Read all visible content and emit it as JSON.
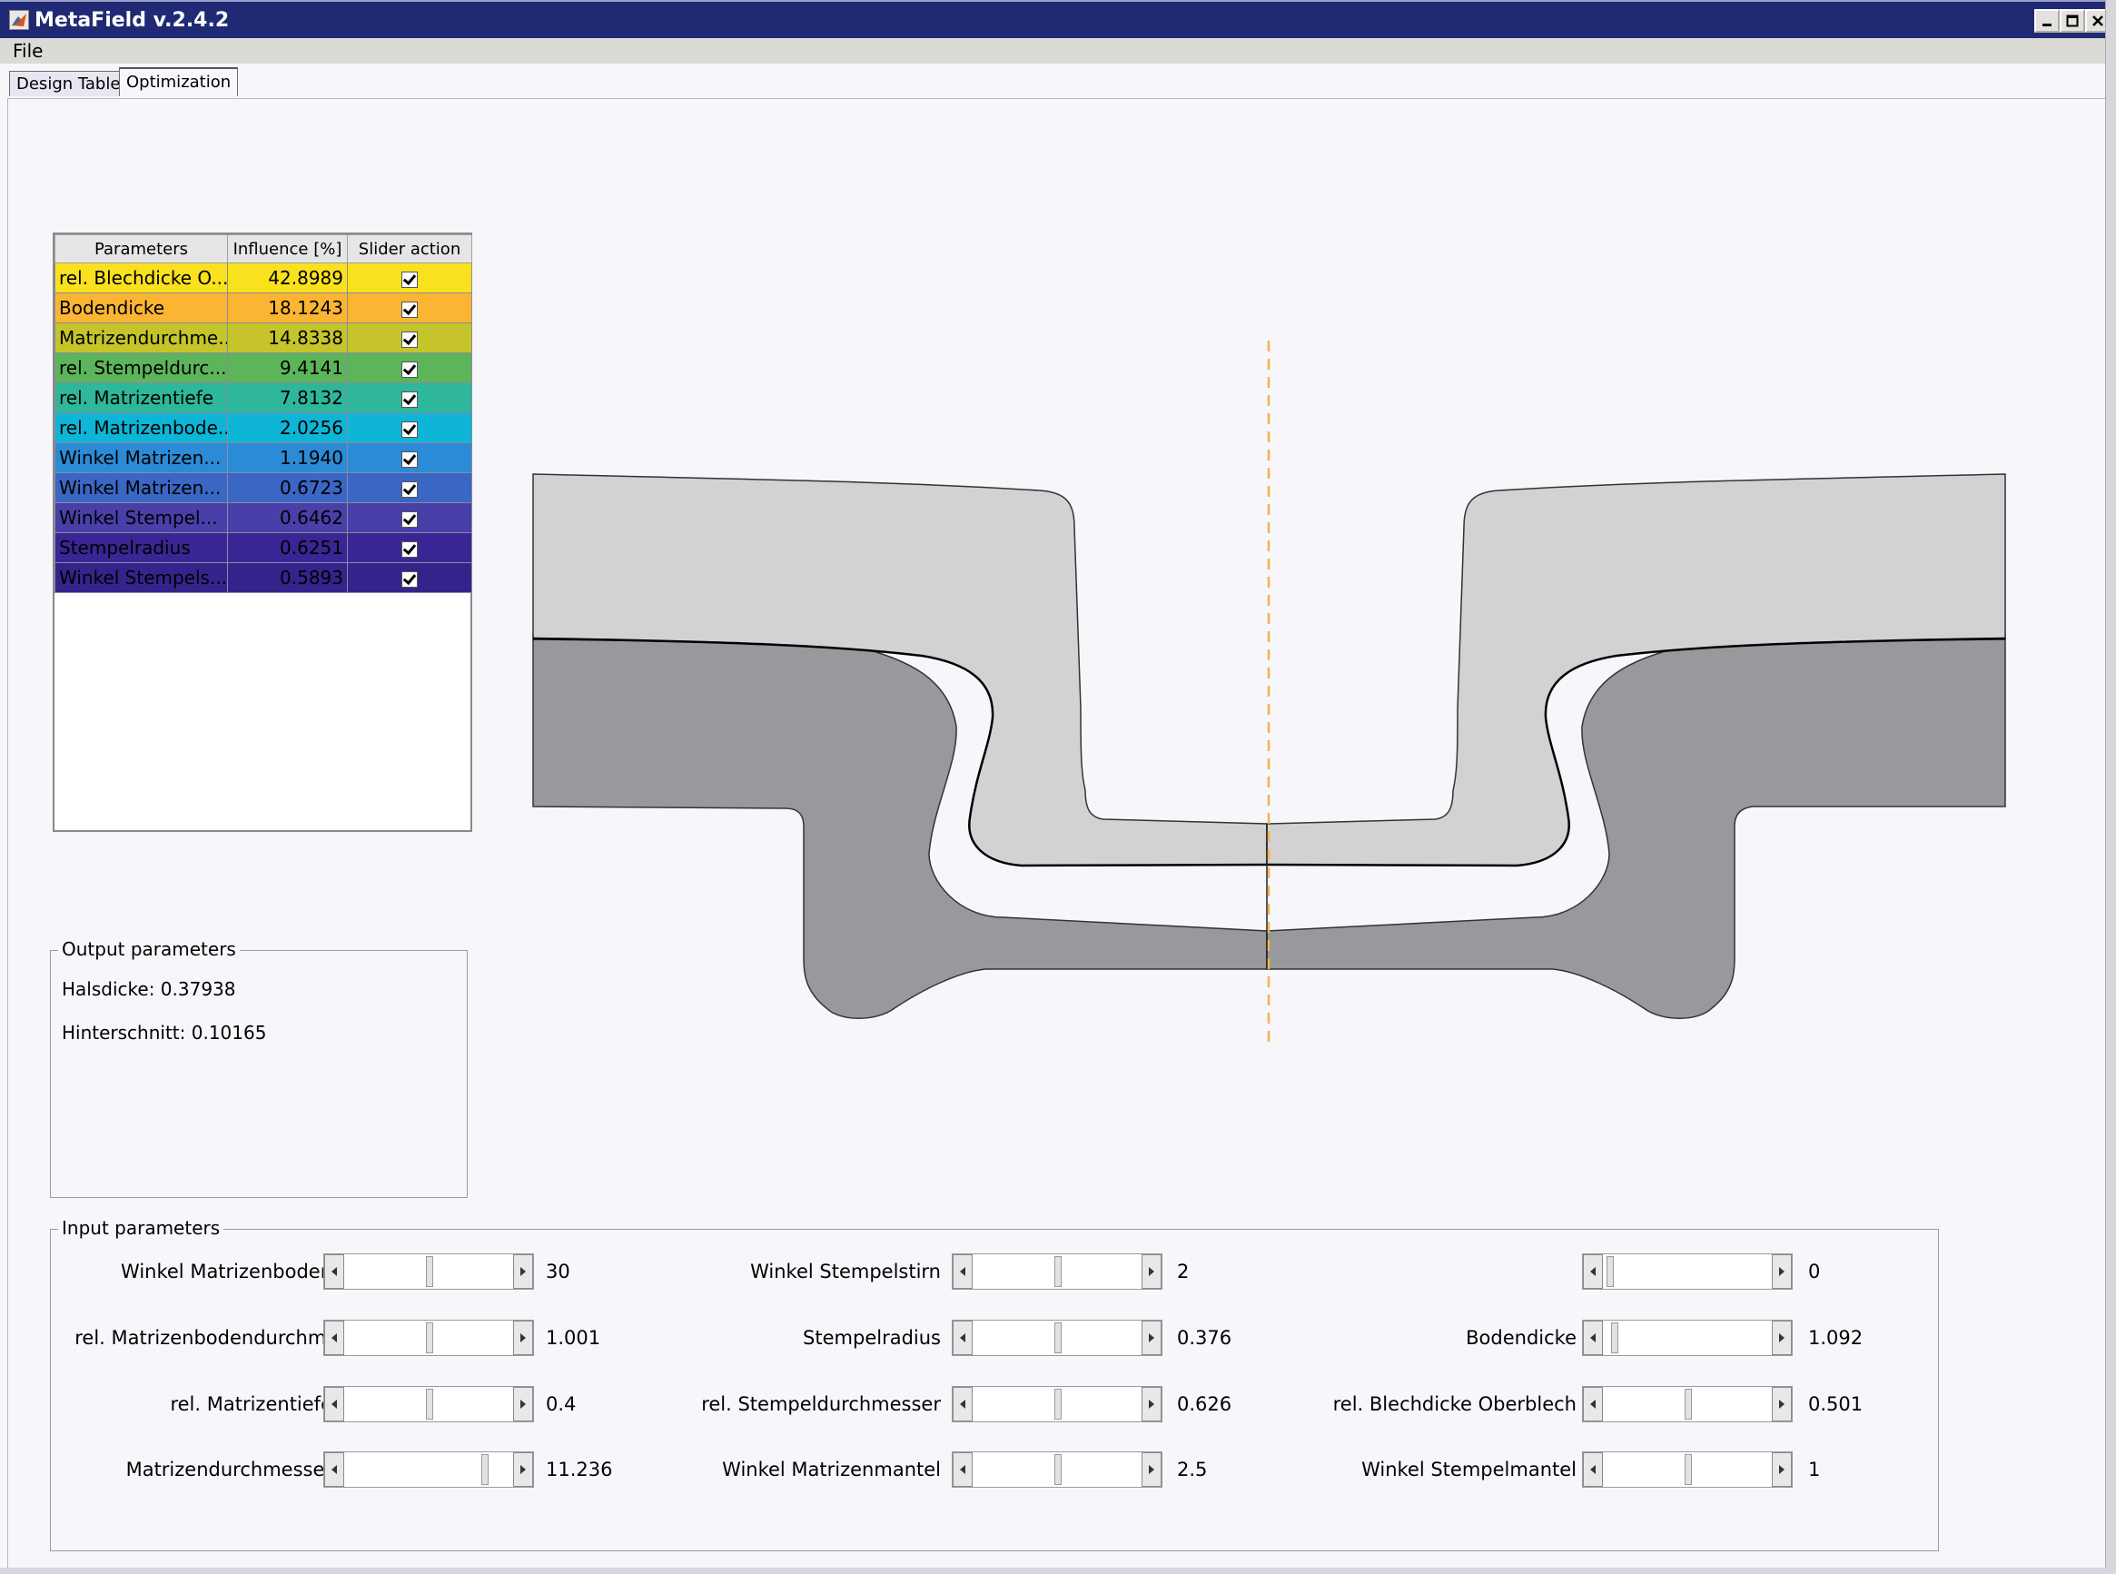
{
  "window": {
    "title": "MetaField v.2.4.2"
  },
  "menu": {
    "file": "File"
  },
  "tabs": [
    {
      "label": "Design Table",
      "active": false
    },
    {
      "label": "Optimization",
      "active": true
    }
  ],
  "table": {
    "headers": [
      "Parameters",
      "Influence [%]",
      "Slider action"
    ],
    "rows": [
      {
        "name": "rel. Blechdicke O...",
        "influence": "42.8989",
        "checked": true,
        "color": "#f9e11e"
      },
      {
        "name": "Bodendicke",
        "influence": "18.1243",
        "checked": true,
        "color": "#fbb532"
      },
      {
        "name": "Matrizendurchme...",
        "influence": "14.8338",
        "checked": true,
        "color": "#c5c42a"
      },
      {
        "name": "rel. Stempeldurc...",
        "influence": "9.4141",
        "checked": true,
        "color": "#5cb55a"
      },
      {
        "name": "rel. Matrizentiefe",
        "influence": "7.8132",
        "checked": true,
        "color": "#2eb79a"
      },
      {
        "name": "rel. Matrizenbode...",
        "influence": "2.0256",
        "checked": true,
        "color": "#0fb5d6"
      },
      {
        "name": "Winkel Matrizen...",
        "influence": "1.1940",
        "checked": true,
        "color": "#2b8bd6"
      },
      {
        "name": "Winkel Matrizen...",
        "influence": "0.6723",
        "checked": true,
        "color": "#3a66c4"
      },
      {
        "name": "Winkel Stempel...",
        "influence": "0.6462",
        "checked": true,
        "color": "#4840a8"
      },
      {
        "name": "Stempelradius",
        "influence": "0.6251",
        "checked": true,
        "color": "#3a2594"
      },
      {
        "name": "Winkel Stempels...",
        "influence": "0.5893",
        "checked": true,
        "color": "#35238c"
      }
    ]
  },
  "output": {
    "title": "Output parameters",
    "halsdicke": "Halsdicke: 0.37938",
    "hinterschnitt": "Hinterschnitt: 0.10165"
  },
  "input": {
    "title": "Input parameters",
    "sliders": [
      {
        "label": "Winkel Matrizenboden",
        "value": "30",
        "level": 0.5
      },
      {
        "label": "rel. Matrizenbodendurchm.",
        "value": "1.001",
        "level": 0.5
      },
      {
        "label": "rel. Matrizentiefe",
        "value": "0.4",
        "level": 0.5
      },
      {
        "label": "Matrizendurchmesser",
        "value": "11.236",
        "level": 0.84
      },
      {
        "label": "Winkel Stempelstirn",
        "value": "2",
        "level": 0.5
      },
      {
        "label": "Stempelradius",
        "value": "0.376",
        "level": 0.5
      },
      {
        "label": "rel. Stempeldurchmesser",
        "value": "0.626",
        "level": 0.5
      },
      {
        "label": "Winkel Matrizenmantel",
        "value": "2.5",
        "level": 0.5
      },
      {
        "label": "",
        "value": "0",
        "level": 0.02
      },
      {
        "label": "Bodendicke",
        "value": "1.092",
        "level": 0.05
      },
      {
        "label": "rel. Blechdicke Oberblech",
        "value": "0.501",
        "level": 0.5
      },
      {
        "label": "Winkel Stempelmantel",
        "value": "1",
        "level": 0.5
      }
    ]
  },
  "colors": {
    "upper_sheet": "#d2d2d2",
    "lower_sheet": "#99989c",
    "axis_line": "#f5b24a"
  }
}
